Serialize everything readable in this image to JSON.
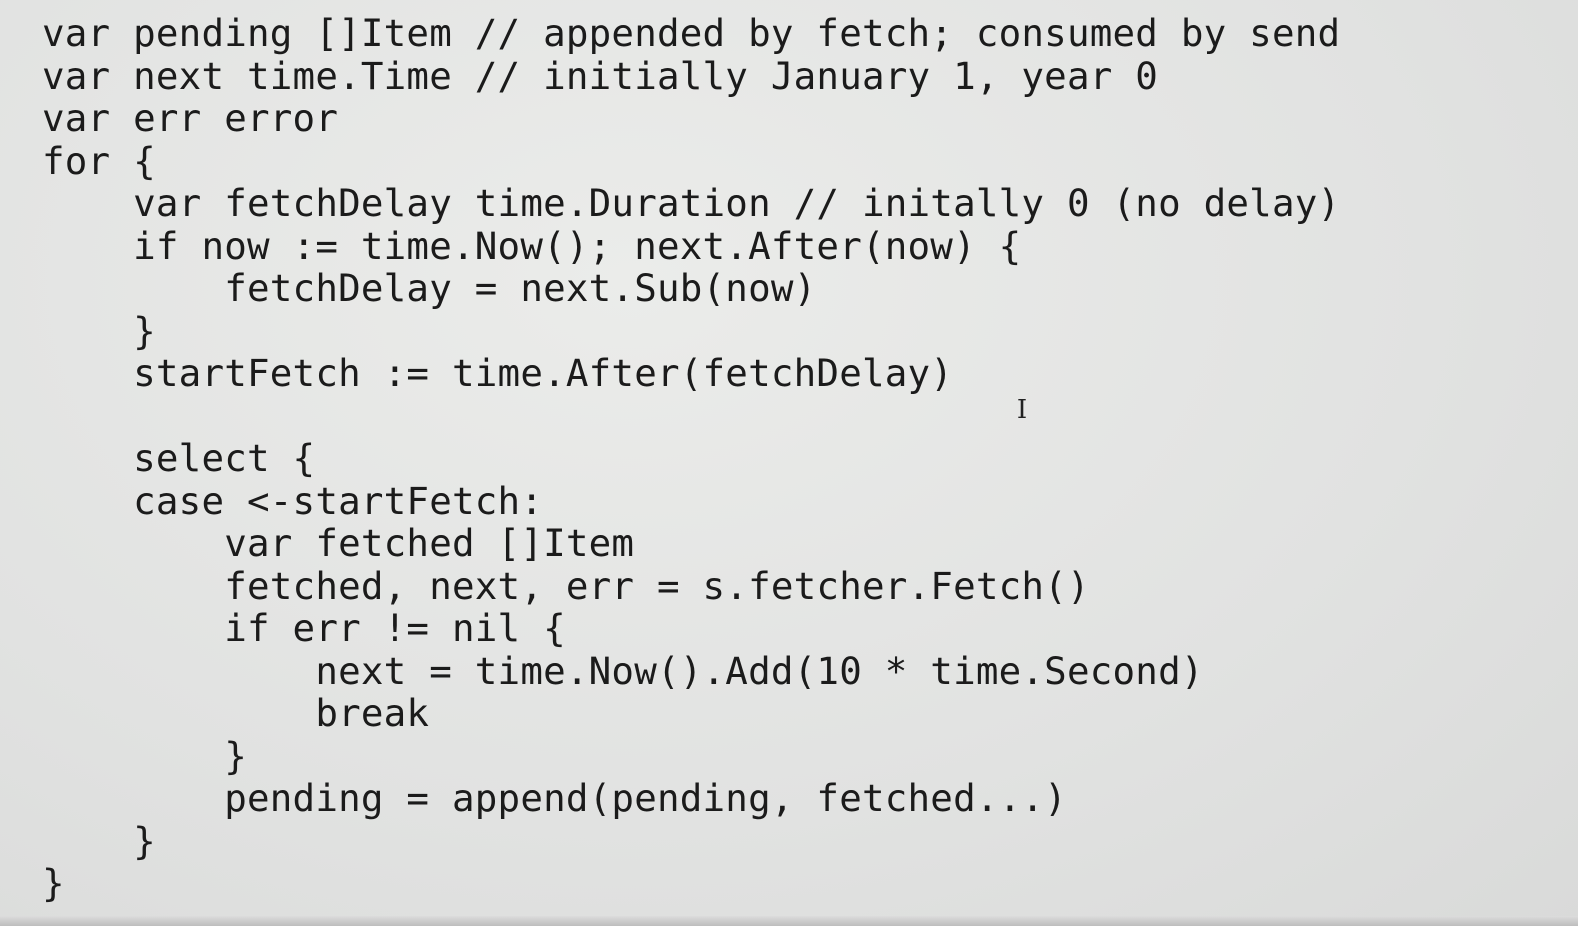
{
  "code_lines": [
    "var pending []Item // appended by fetch; consumed by send",
    "var next time.Time // initially January 1, year 0",
    "var err error",
    "for {",
    "    var fetchDelay time.Duration // initally 0 (no delay)",
    "    if now := time.Now(); next.After(now) {",
    "        fetchDelay = next.Sub(now)",
    "    }",
    "    startFetch := time.After(fetchDelay)",
    "",
    "    select {",
    "    case <-startFetch:",
    "        var fetched []Item",
    "        fetched, next, err = s.fetcher.Fetch()",
    "        if err != nil {",
    "            next = time.Now().Add(10 * time.Second)",
    "            break",
    "        }",
    "        pending = append(pending, fetched...)",
    "    }",
    "}"
  ],
  "cursor": {
    "icon": "i-beam-cursor-icon",
    "glyph": "I"
  },
  "colors": {
    "background": "#e4e5e4",
    "text": "#1b1b1b"
  }
}
